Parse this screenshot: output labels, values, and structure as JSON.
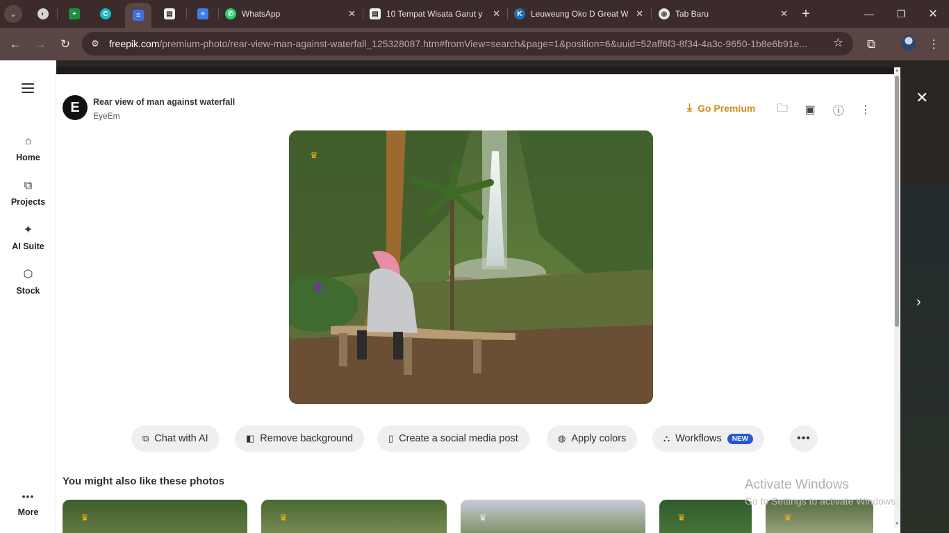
{
  "browser": {
    "tabs": [
      {
        "title": "",
        "icon": "globe-icon",
        "active": false
      },
      {
        "title": "",
        "icon": "sheets-icon",
        "active": false
      },
      {
        "title": "",
        "icon": "canva-icon",
        "active": false
      },
      {
        "title": "",
        "icon": "forms-icon",
        "active": true
      },
      {
        "title": "",
        "icon": "news-icon",
        "active": false
      },
      {
        "title": "",
        "icon": "docs-icon",
        "active": false
      },
      {
        "title": "WhatsApp",
        "icon": "whatsapp-icon",
        "active": false
      },
      {
        "title": "10 Tempat Wisata Garut y",
        "icon": "news-icon",
        "active": false
      },
      {
        "title": "Leuweung Oko D Great W",
        "icon": "k-icon",
        "active": false
      },
      {
        "title": "Tab Baru",
        "icon": "chrome-icon",
        "active": false
      }
    ],
    "url_host": "freepik.com",
    "url_path": "/premium-photo/rear-view-man-against-waterfall_125328087.htm#fromView=search&page=1&position=6&uuid=52aff6f3-8f34-4a3c-9650-1b8e6b91e..."
  },
  "sidebar": {
    "items": [
      {
        "label": "Home",
        "icon": "home-icon"
      },
      {
        "label": "Projects",
        "icon": "projects-icon"
      },
      {
        "label": "AI Suite",
        "icon": "ai-suite-icon"
      },
      {
        "label": "Stock",
        "icon": "stock-icon"
      }
    ],
    "more_label": "More"
  },
  "photo": {
    "author_initial": "E",
    "title": "Rear view of man against waterfall",
    "author": "EyeEm"
  },
  "actions": {
    "go_premium": "Go Premium",
    "chat_ai": "Chat with AI",
    "remove_bg": "Remove background",
    "social_post": "Create a social media post",
    "apply_colors": "Apply colors",
    "workflows": "Workflows",
    "new_badge": "NEW"
  },
  "similar": {
    "heading": "You might also like these photos"
  },
  "watermark": {
    "line1": "Activate Windows",
    "line2": "Go to Settings to activate Windows."
  },
  "colors": {
    "premium_accent": "#d18b1a",
    "badge_blue": "#2457d6",
    "tab_strip": "#3c2b2b"
  }
}
